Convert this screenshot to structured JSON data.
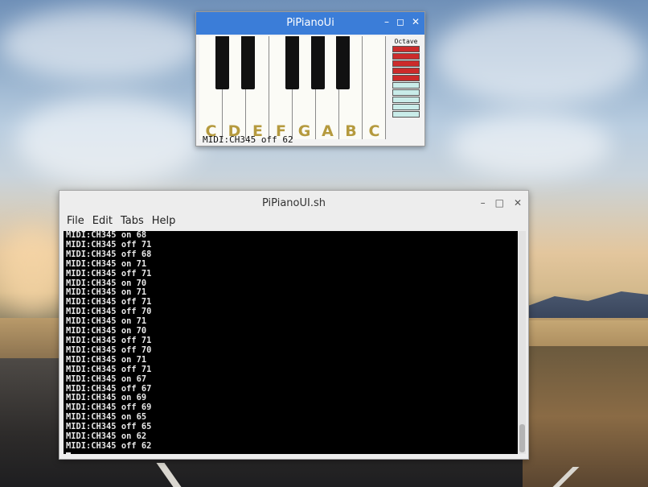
{
  "piano_window": {
    "title": "PiPianoUi",
    "buttons": [
      "–",
      "◻",
      "✕"
    ],
    "notes": [
      "C",
      "D",
      "E",
      "F",
      "G",
      "A",
      "B",
      "C"
    ],
    "octave_label": "Octave",
    "octave_level": 5,
    "octave_steps": 10,
    "status": "MIDI:CH345 off 62"
  },
  "terminal_window": {
    "title": "PiPianoUI.sh",
    "buttons": [
      "–",
      "□",
      "✕"
    ],
    "menu": [
      "File",
      "Edit",
      "Tabs",
      "Help"
    ],
    "lines": [
      "MIDI:CH345 on 68",
      "MIDI:CH345 off 71",
      "MIDI:CH345 off 68",
      "MIDI:CH345 on 71",
      "MIDI:CH345 off 71",
      "MIDI:CH345 on 70",
      "MIDI:CH345 on 71",
      "MIDI:CH345 off 71",
      "MIDI:CH345 off 70",
      "MIDI:CH345 on 71",
      "MIDI:CH345 on 70",
      "MIDI:CH345 off 71",
      "MIDI:CH345 off 70",
      "MIDI:CH345 on 71",
      "MIDI:CH345 off 71",
      "MIDI:CH345 on 67",
      "MIDI:CH345 off 67",
      "MIDI:CH345 on 69",
      "MIDI:CH345 off 69",
      "MIDI:CH345 on 65",
      "MIDI:CH345 off 65",
      "MIDI:CH345 on 62",
      "MIDI:CH345 off 62"
    ]
  },
  "colors": {
    "titlebar": "#3b7dd8",
    "octave_on": "#cc2b2b",
    "octave_off": "#c9ece9",
    "note_label": "#b59a3e",
    "terminal_bg": "#000000"
  }
}
